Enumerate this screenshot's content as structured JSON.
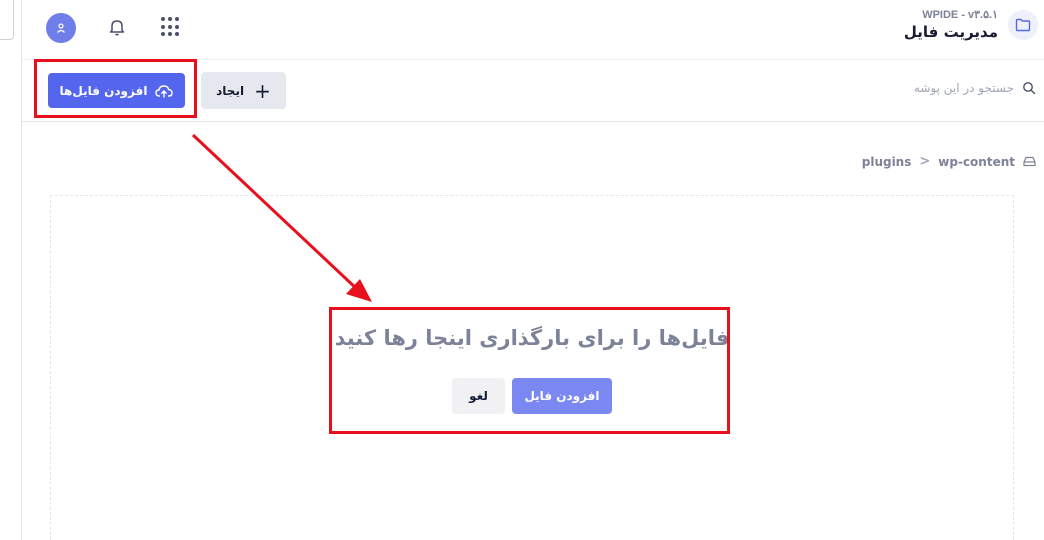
{
  "header": {
    "version": "WPIDE - v۳.۵.۱",
    "title": "مدیریت فایل"
  },
  "toolbar": {
    "upload_label": "افزودن فایل‌ها",
    "create_label": "ایجاد",
    "search_placeholder": "جستجو در این پوشه"
  },
  "breadcrumb": {
    "items": [
      "wp-content",
      "plugins"
    ],
    "separator": ">"
  },
  "dropzone": {
    "title": "فایل‌ها را برای بارگذاری اینجا رها کنید",
    "add_file_label": "افزودن فایل",
    "cancel_label": "لغو"
  },
  "colors": {
    "primary": "#5566ee",
    "primary_light": "#7b88f2",
    "highlight": "#e8101d"
  },
  "icons": [
    "folder-icon",
    "user-icon",
    "bell-icon",
    "apps-grid-icon",
    "search-icon",
    "upload-cloud-icon",
    "plus-icon",
    "drive-icon"
  ]
}
